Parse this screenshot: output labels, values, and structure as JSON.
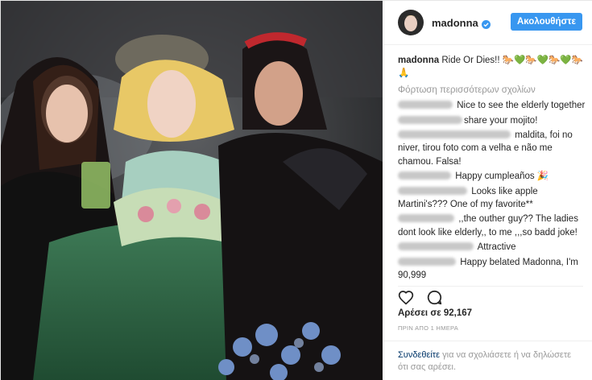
{
  "header": {
    "username": "madonna",
    "follow_label": "Ακολουθήστε"
  },
  "caption": {
    "username": "madonna",
    "text": "Ride Or Dies!! 🐎💚🐎💚🐎💚🐎🙏"
  },
  "load_more": "Φόρτωση περισσότερων σχολίων",
  "comments": [
    {
      "text": "Nice to see the elderly together"
    },
    {
      "text": "share your mojito!"
    },
    {
      "text": "maldita, foi no niver, tirou foto com a velha e não me chamou. Falsa!"
    },
    {
      "text": "Happy cumpleaños 🎉"
    },
    {
      "text": "Looks like apple Martini's??? One of my favorite**"
    },
    {
      "text": ",,the outher guy?? The ladies dont look like elderly,, to me ,,,so badd joke!"
    },
    {
      "text": "Attractive"
    },
    {
      "text": "Happy belated Madonna, I'm 90,999"
    }
  ],
  "likes": "Αρέσει σε 92,167",
  "timestamp": "ΠΡΙΝ ΑΠΟ 1 ΗΜΕΡΑ",
  "footer": {
    "login_link": "Συνδεθείτε",
    "text": " για να σχολιάσετε ή να δηλώσετε ότι σας αρέσει."
  },
  "icons": {
    "like": "heart-icon",
    "comment": "comment-bubble-icon",
    "verified": "verified-badge-icon"
  },
  "colors": {
    "follow_button": "#3897f0",
    "link": "#003569",
    "muted": "#999999"
  }
}
